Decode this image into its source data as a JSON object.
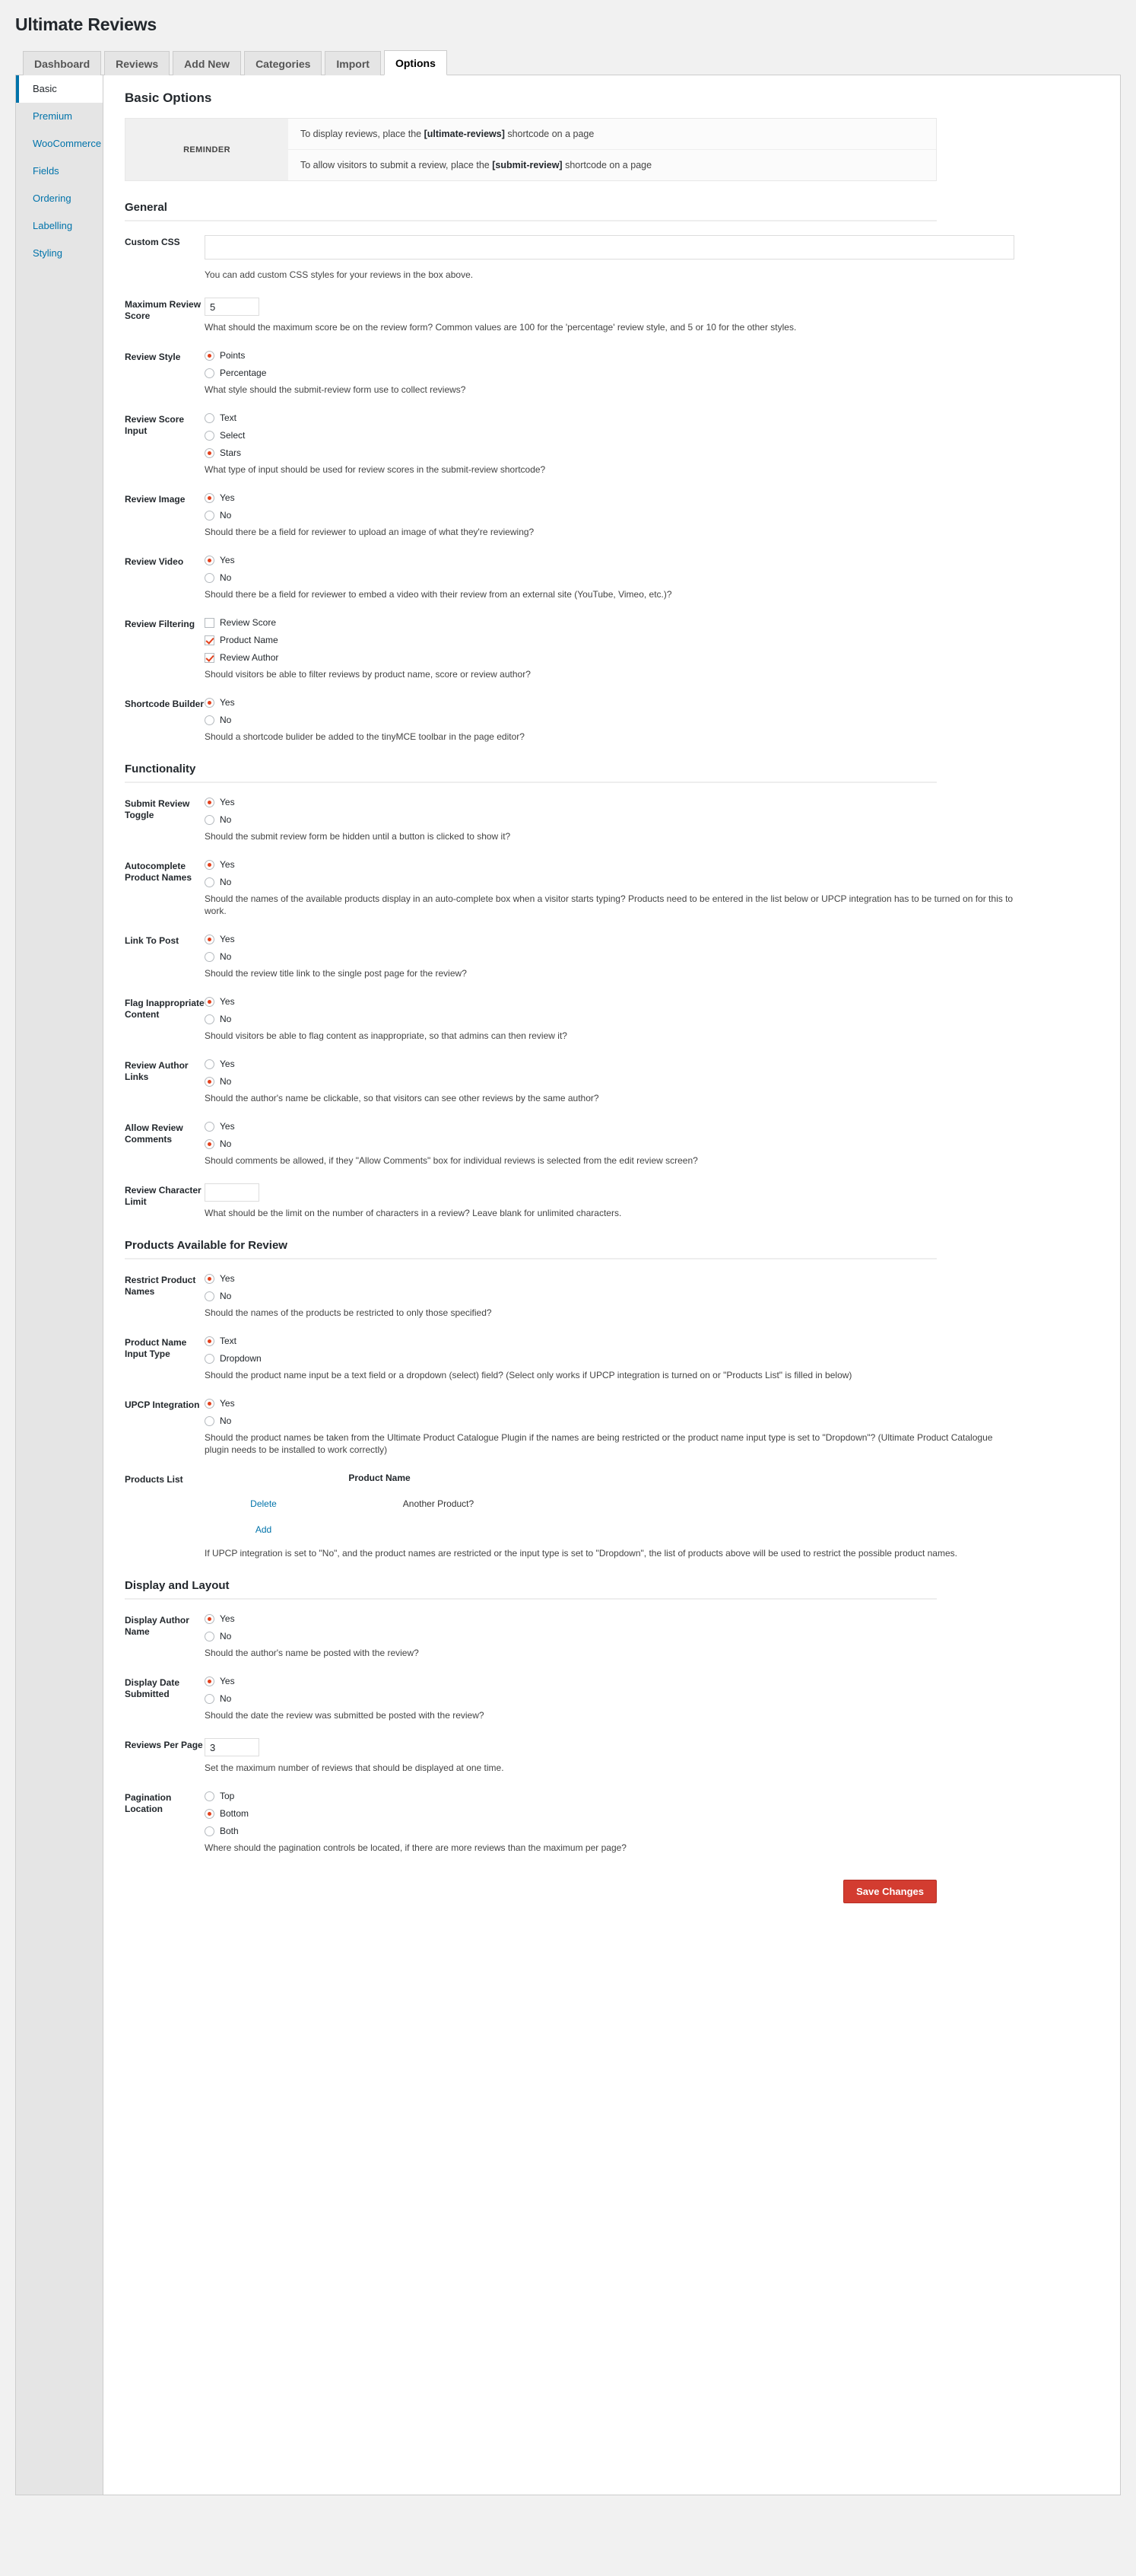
{
  "page": {
    "title": "Ultimate Reviews"
  },
  "tabs": [
    {
      "label": "Dashboard",
      "active": false
    },
    {
      "label": "Reviews",
      "active": false
    },
    {
      "label": "Add New",
      "active": false
    },
    {
      "label": "Categories",
      "active": false
    },
    {
      "label": "Import",
      "active": false
    },
    {
      "label": "Options",
      "active": true
    }
  ],
  "sidebar": {
    "items": [
      {
        "label": "Basic",
        "active": true
      },
      {
        "label": "Premium",
        "active": false
      },
      {
        "label": "WooCommerce",
        "active": false
      },
      {
        "label": "Fields",
        "active": false
      },
      {
        "label": "Ordering",
        "active": false
      },
      {
        "label": "Labelling",
        "active": false
      },
      {
        "label": "Styling",
        "active": false
      }
    ]
  },
  "main": {
    "heading": "Basic Options",
    "reminder": {
      "label": "REMINDER",
      "lines": [
        {
          "pre": "To display reviews, place the ",
          "code": "[ultimate-reviews]",
          "post": " shortcode on a page"
        },
        {
          "pre": "To allow visitors to submit a review, place the ",
          "code": "[submit-review]",
          "post": " shortcode on a page"
        }
      ]
    },
    "sections": [
      {
        "title": "General",
        "fields": [
          {
            "label": "Custom CSS",
            "type": "textarea",
            "value": "",
            "desc": "You can add custom CSS styles for your reviews in the box above."
          },
          {
            "label": "Maximum Review Score",
            "type": "text",
            "value": "5",
            "desc": "What should the maximum score be on the review form? Common values are 100 for the 'percentage' review style, and 5 or 10 for the other styles."
          },
          {
            "label": "Review Style",
            "type": "radio",
            "options": [
              {
                "label": "Points",
                "checked": true
              },
              {
                "label": "Percentage",
                "checked": false
              }
            ],
            "desc": "What style should the submit-review form use to collect reviews?"
          },
          {
            "label": "Review Score Input",
            "type": "radio",
            "options": [
              {
                "label": "Text",
                "checked": false
              },
              {
                "label": "Select",
                "checked": false
              },
              {
                "label": "Stars",
                "checked": true
              }
            ],
            "desc": "What type of input should be used for review scores in the submit-review shortcode?"
          },
          {
            "label": "Review Image",
            "type": "radio",
            "options": [
              {
                "label": "Yes",
                "checked": true
              },
              {
                "label": "No",
                "checked": false
              }
            ],
            "desc": "Should there be a field for reviewer to upload an image of what they're reviewing?"
          },
          {
            "label": "Review Video",
            "type": "radio",
            "options": [
              {
                "label": "Yes",
                "checked": true
              },
              {
                "label": "No",
                "checked": false
              }
            ],
            "desc": "Should there be a field for reviewer to embed a video with their review from an external site (YouTube, Vimeo, etc.)?"
          },
          {
            "label": "Review Filtering",
            "type": "checkbox",
            "options": [
              {
                "label": "Review Score",
                "checked": false
              },
              {
                "label": "Product Name",
                "checked": true
              },
              {
                "label": "Review Author",
                "checked": true
              }
            ],
            "desc": "Should visitors be able to filter reviews by product name, score or review author?"
          },
          {
            "label": "Shortcode Builder",
            "type": "radio",
            "options": [
              {
                "label": "Yes",
                "checked": true
              },
              {
                "label": "No",
                "checked": false
              }
            ],
            "desc": "Should a shortcode bulider be added to the tinyMCE toolbar in the page editor?"
          }
        ]
      },
      {
        "title": "Functionality",
        "fields": [
          {
            "label": "Submit Review Toggle",
            "type": "radio",
            "options": [
              {
                "label": "Yes",
                "checked": true
              },
              {
                "label": "No",
                "checked": false
              }
            ],
            "desc": "Should the submit review form be hidden until a button is clicked to show it?"
          },
          {
            "label": "Autocomplete Product Names",
            "type": "radio",
            "options": [
              {
                "label": "Yes",
                "checked": true
              },
              {
                "label": "No",
                "checked": false
              }
            ],
            "desc": "Should the names of the available products display in an auto-complete box when a visitor starts typing? Products need to be entered in the list below or UPCP integration has to be turned on for this to work."
          },
          {
            "label": "Link To Post",
            "type": "radio",
            "options": [
              {
                "label": "Yes",
                "checked": true
              },
              {
                "label": "No",
                "checked": false
              }
            ],
            "desc": "Should the review title link to the single post page for the review?"
          },
          {
            "label": "Flag Inappropriate Content",
            "type": "radio",
            "options": [
              {
                "label": "Yes",
                "checked": true
              },
              {
                "label": "No",
                "checked": false
              }
            ],
            "desc": "Should visitors be able to flag content as inappropriate, so that admins can then review it?"
          },
          {
            "label": "Review Author Links",
            "type": "radio",
            "options": [
              {
                "label": "Yes",
                "checked": false
              },
              {
                "label": "No",
                "checked": true
              }
            ],
            "desc": "Should the author's name be clickable, so that visitors can see other reviews by the same author?"
          },
          {
            "label": "Allow Review Comments",
            "type": "radio",
            "options": [
              {
                "label": "Yes",
                "checked": false
              },
              {
                "label": "No",
                "checked": true
              }
            ],
            "desc": "Should comments be allowed, if they \"Allow Comments\" box for individual reviews is selected from the edit review screen?"
          },
          {
            "label": "Review Character Limit",
            "type": "text",
            "value": "",
            "desc": "What should be the limit on the number of characters in a review? Leave blank for unlimited characters."
          }
        ]
      },
      {
        "title": "Products Available for Review",
        "fields": [
          {
            "label": "Restrict Product Names",
            "type": "radio",
            "options": [
              {
                "label": "Yes",
                "checked": true
              },
              {
                "label": "No",
                "checked": false
              }
            ],
            "desc": "Should the names of the products be restricted to only those specified?"
          },
          {
            "label": "Product Name Input Type",
            "type": "radio",
            "options": [
              {
                "label": "Text",
                "checked": true
              },
              {
                "label": "Dropdown",
                "checked": false
              }
            ],
            "desc": "Should the product name input be a text field or a dropdown (select) field? (Select only works if UPCP integration is turned on or \"Products List\" is filled in below)"
          },
          {
            "label": "UPCP Integration",
            "type": "radio",
            "options": [
              {
                "label": "Yes",
                "checked": true
              },
              {
                "label": "No",
                "checked": false
              }
            ],
            "desc": "Should the product names be taken from the Ultimate Product Catalogue Plugin if the names are being restricted or the product name input type is set to \"Dropdown\"? (Ultimate Product Catalogue plugin needs to be installed to work correctly)"
          },
          {
            "label": "Products List",
            "type": "products",
            "column_header": "Product Name",
            "rows": [
              {
                "delete_label": "Delete",
                "name": "Another Product?"
              }
            ],
            "add_label": "Add",
            "desc": "If UPCP integration is set to \"No\", and the product names are restricted or the input type is set to \"Dropdown\", the list of products above will be used to restrict the possible product names."
          }
        ]
      },
      {
        "title": "Display and Layout",
        "fields": [
          {
            "label": "Display Author Name",
            "type": "radio",
            "options": [
              {
                "label": "Yes",
                "checked": true
              },
              {
                "label": "No",
                "checked": false
              }
            ],
            "desc": "Should the author's name be posted with the review?"
          },
          {
            "label": "Display Date Submitted",
            "type": "radio",
            "options": [
              {
                "label": "Yes",
                "checked": true
              },
              {
                "label": "No",
                "checked": false
              }
            ],
            "desc": "Should the date the review was submitted be posted with the review?"
          },
          {
            "label": "Reviews Per Page",
            "type": "text",
            "value": "3",
            "desc": "Set the maximum number of reviews that should be displayed at one time."
          },
          {
            "label": "Pagination Location",
            "type": "radio",
            "options": [
              {
                "label": "Top",
                "checked": false
              },
              {
                "label": "Bottom",
                "checked": true
              },
              {
                "label": "Both",
                "checked": false
              }
            ],
            "desc": "Where should the pagination controls be located, if there are more reviews than the maximum per page?"
          }
        ]
      }
    ],
    "save_label": "Save Changes"
  },
  "colors": {
    "accent_red": "#e2401c",
    "link_blue": "#0073aa",
    "save_button": "#d33c30"
  }
}
